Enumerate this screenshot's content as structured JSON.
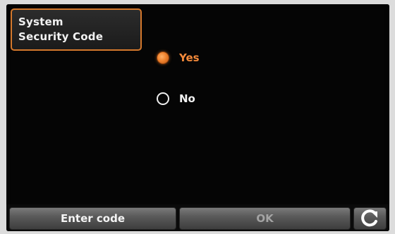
{
  "header": {
    "line1": "System",
    "line2": "Security Code"
  },
  "options": [
    {
      "label": "Yes",
      "selected": true
    },
    {
      "label": "No",
      "selected": false
    }
  ],
  "footer": {
    "enter_code_label": "Enter code",
    "ok_label": "OK",
    "back_icon": "back-arrow-icon"
  },
  "colors": {
    "accent": "#f0832e",
    "background": "#050505",
    "button_text_disabled": "#a4a4a4"
  }
}
